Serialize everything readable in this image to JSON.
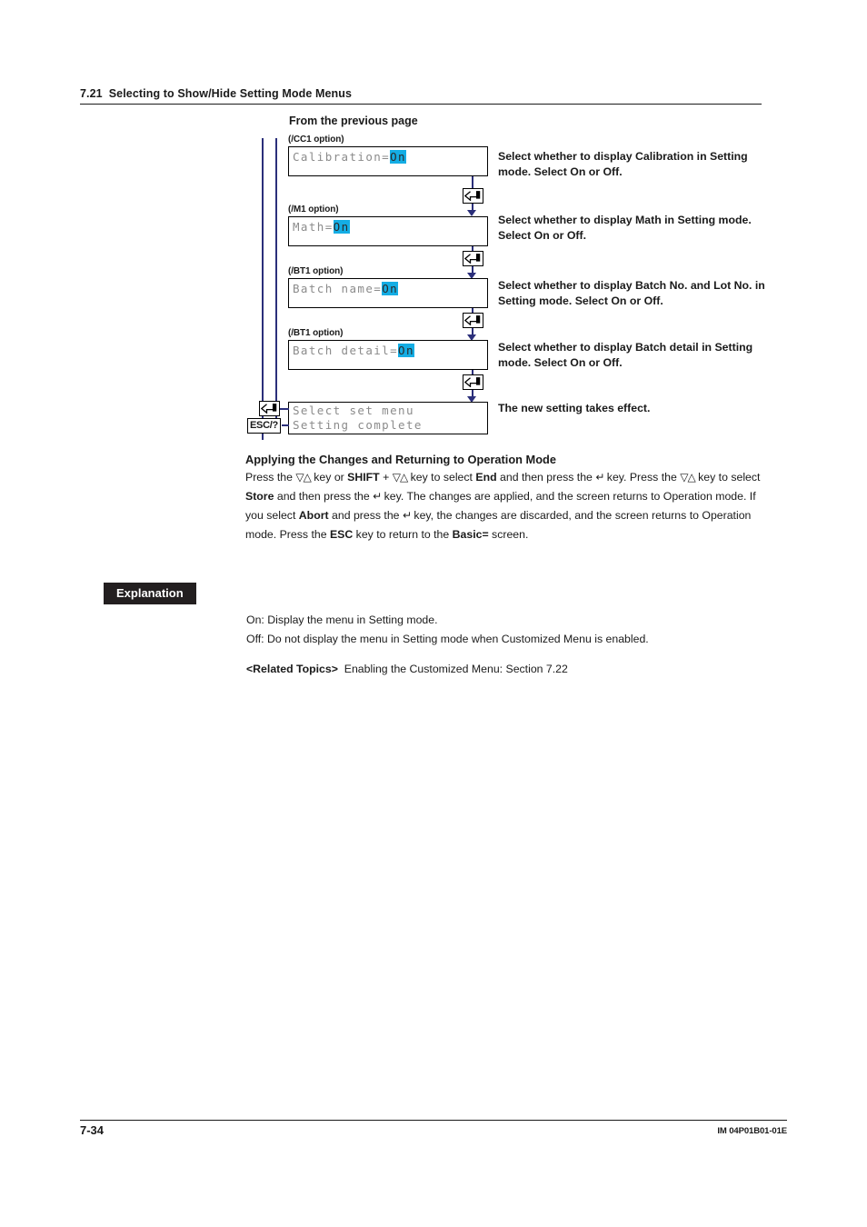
{
  "header": {
    "section_number": "7.21",
    "section_title": "Selecting to Show/Hide Setting Mode Menus"
  },
  "diagram": {
    "entry_label": "From the previous page",
    "enter_key_icon": "enter-key-icon",
    "esc_key_label": "ESC/?",
    "steps": [
      {
        "option": "(/CC1 option)",
        "lcd_prefix": "Calibration=",
        "lcd_value": "On",
        "description": "Select whether to display Calibration in Setting mode. Select On or Off."
      },
      {
        "option": "(/M1 option)",
        "lcd_prefix": "Math=",
        "lcd_value": "On",
        "description": "Select whether to display Math in Setting mode. Select On or Off."
      },
      {
        "option": "(/BT1 option)",
        "lcd_prefix": "Batch name=",
        "lcd_value": "On",
        "description": "Select whether to display Batch No. and Lot No. in Setting mode. Select On or Off."
      },
      {
        "option": "(/BT1 option)",
        "lcd_prefix": "Batch detail=",
        "lcd_value": "On",
        "description": "Select whether to display Batch detail in Setting mode. Select On or Off."
      }
    ],
    "final": {
      "lcd_line1": "Select set menu",
      "lcd_line2": "Setting complete",
      "description": "The new setting takes effect."
    }
  },
  "applying": {
    "heading": "Applying the Changes and Returning to Operation Mode",
    "t1": "Press the ",
    "k1": "▽△",
    "t2": " key or ",
    "b1": "SHIFT",
    "t3": " + ",
    "k2": "▽△",
    "t4": " key to select ",
    "b2": "End",
    "t5": " and then press the ",
    "k3": "↵",
    "t6": " key. Press the ",
    "k4": "▽△",
    "t7": " key to select ",
    "b3": "Store",
    "t8": " and then press the ",
    "k5": "↵",
    "t9": " key. The changes are applied, and the screen returns to Operation mode. If you select ",
    "b4": "Abort",
    "t10": " and press the ",
    "k6": "↵",
    "t11": " key, the changes are discarded, and the screen returns to Operation mode. Press the ",
    "b5": "ESC",
    "t12": " key to return to the ",
    "b6": "Basic=",
    "t13": " screen."
  },
  "explanation": {
    "tag": "Explanation",
    "line_on": "On: Display the menu in Setting mode.",
    "line_off": "Off: Do not display the menu in Setting mode when Customized Menu is enabled.",
    "related_label": "<Related Topics>",
    "related_text": "Enabling the Customized Menu: Section 7.22"
  },
  "footer": {
    "page_number": "7-34",
    "document_number": "IM 04P01B01-01E"
  },
  "colors": {
    "lcd_highlight": "#14ade4",
    "flow_line": "#2b2f7a",
    "tag_bg": "#231f20"
  }
}
